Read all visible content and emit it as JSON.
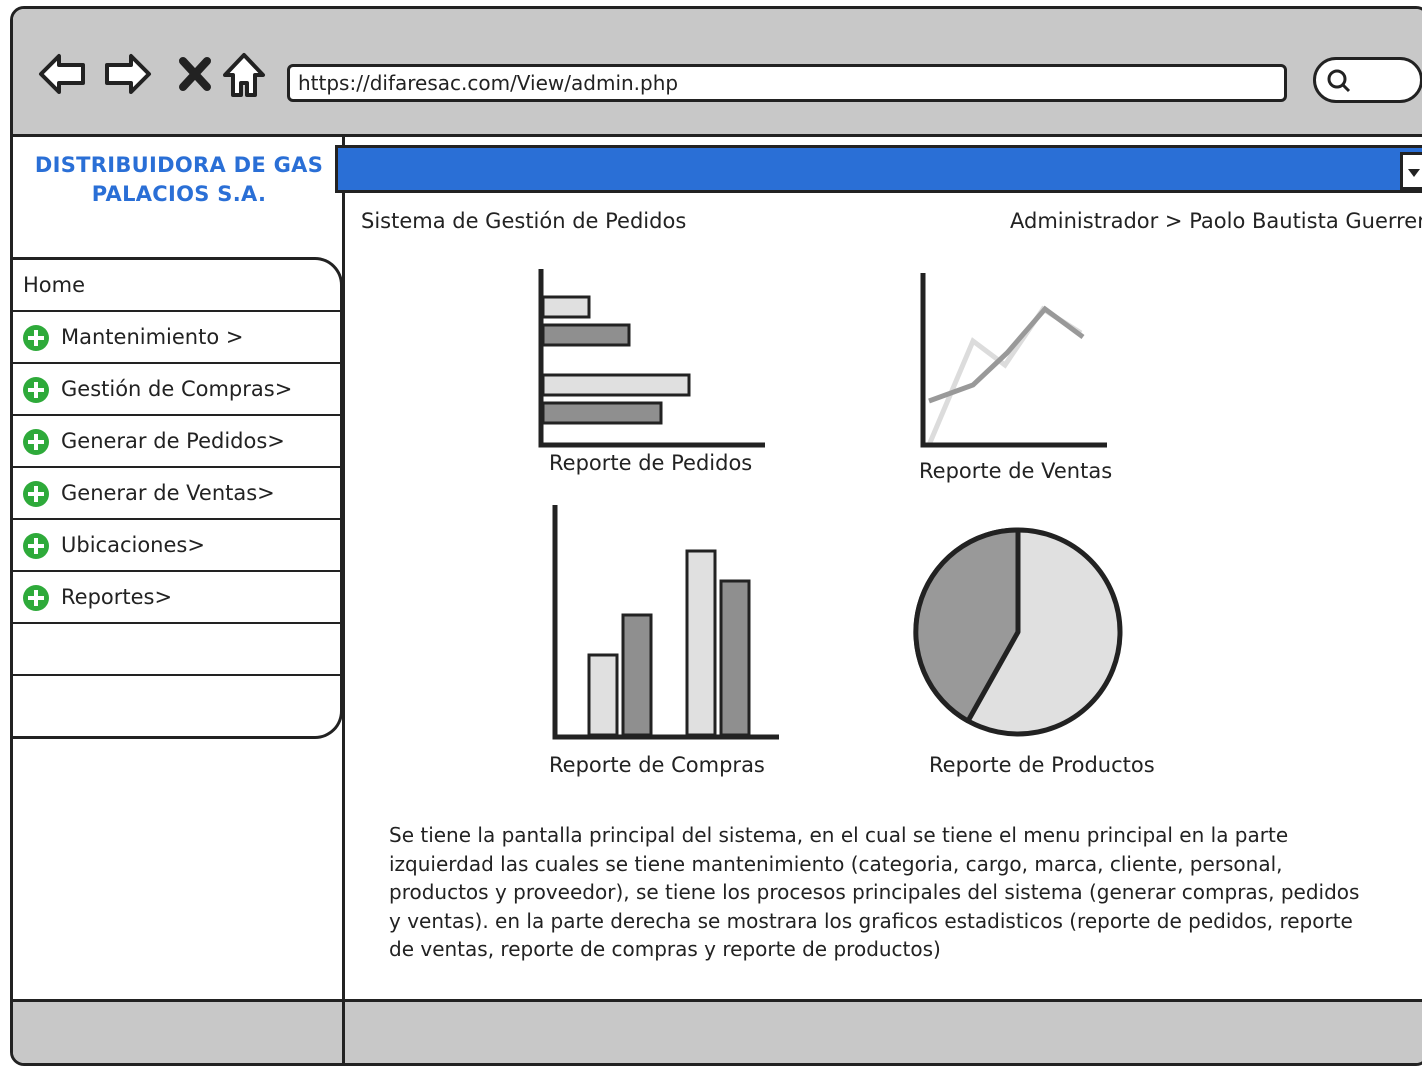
{
  "browser": {
    "url": "https://difaresac.com/View/admin.php",
    "icons": [
      "back-arrow-icon",
      "forward-arrow-icon",
      "close-x-icon",
      "home-icon",
      "search-icon"
    ]
  },
  "sidebar": {
    "brand_line1": "DISTRIBUIDORA DE GAS",
    "brand_line2": "PALACIOS S.A.",
    "items": [
      {
        "label": "Home"
      },
      {
        "label": "Mantenimiento >"
      },
      {
        "label": "Gestión de Compras>"
      },
      {
        "label": "Generar de Pedidos>"
      },
      {
        "label": "Generar de Ventas>"
      },
      {
        "label": "Ubicaciones>"
      },
      {
        "label": "Reportes>"
      },
      {
        "label": ""
      },
      {
        "label": ""
      }
    ]
  },
  "header": {
    "system_title": "Sistema de Gestión de Pedidos",
    "breadcrumb": "Administrador > Paolo Bautista Guerrer"
  },
  "reports": {
    "pedidos": "Reporte de Pedidos",
    "ventas": "Reporte de Ventas",
    "compras": "Reporte de Compras",
    "productos": "Reporte de Productos"
  },
  "description": "Se tiene la pantalla principal del sistema, en el cual se tiene el menu principal en la parte izquierdad las cuales se tiene mantenimiento (categoria, cargo, marca, cliente, personal, productos y proveedor), se tiene los procesos principales del sistema (generar compras, pedidos y ventas). en la parte derecha se mostrara los graficos estadisticos (reporte de pedidos, reporte de ventas, reporte de compras y reporte de productos)",
  "colors": {
    "accent_blue": "#2a6fd6",
    "plus_green": "#2eaa3a",
    "chrome_gray": "#c8c8c8"
  }
}
